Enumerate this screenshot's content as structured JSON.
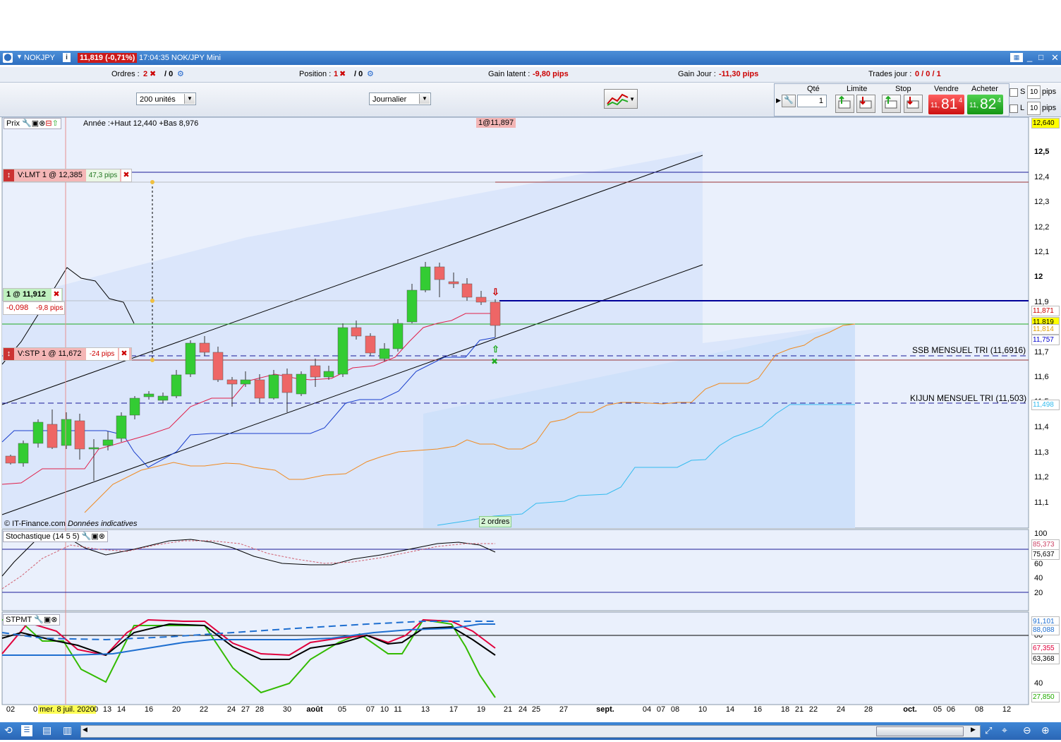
{
  "window": {
    "instrument": "NOKJPY",
    "price_badge": "11,819 (-0,71%)",
    "time_title": "17:04:35 NOK/JPY Mini"
  },
  "infobar": {
    "orders_label": "Ordres :",
    "orders_value": "2",
    "orders_sep": "/ 0",
    "position_label": "Position :",
    "position_value": "1",
    "position_sep": "/ 0",
    "latent_label": "Gain latent :",
    "latent_value": "-9,80 pips",
    "day_label": "Gain Jour :",
    "day_value": "-11,30 pips",
    "trades_label": "Trades jour :",
    "trades_value": "0 / 0 / 1"
  },
  "toolbar": {
    "units_select": "200 unités",
    "period_select": "Journalier",
    "qty_label": "Qté",
    "qty_value": "1",
    "limit_label": "Limite",
    "stop_label": "Stop",
    "sell_label": "Vendre",
    "buy_label": "Acheter",
    "sell_small": "11,",
    "sell_big": "81",
    "sell_sup": "4",
    "buy_small": "11,",
    "buy_big": "82",
    "buy_sup": "4",
    "s_label": "S",
    "l_label": "L",
    "s_pips": "10",
    "l_pips": "10",
    "pips_unit": "pips"
  },
  "price_panel": {
    "header": "Prix",
    "year_info": "Année :+Haut 12,440 +Bas 8,976",
    "top_order_tag": "1@11,897",
    "credit_1": "© IT-Finance.com",
    "credit_2": "Données indicatives",
    "orders_tag": "2 ordres",
    "ssb_label": "SSB MENSUEL TRI (11,6916)",
    "kijun_label": "KIJUN MENSUEL TRI (11,503)",
    "limit_order": {
      "label": "V:LMT  1 @ 12,385",
      "pips": "47,3 pips"
    },
    "position": {
      "label": "1 @ 11,912",
      "delta": "-0,098",
      "pips": "-9,8 pips"
    },
    "stop_order": {
      "label": "V:STP  1 @ 11,672",
      "pips": "-24 pips"
    },
    "y_ticks": [
      "12,5",
      "12,4",
      "12,3",
      "12,2",
      "12,1",
      "12",
      "11,9",
      "11,8",
      "11,7",
      "11,6",
      "11,5",
      "11,4",
      "11,3",
      "11,2",
      "11,1"
    ],
    "y_boxes": [
      {
        "text": "12,640",
        "bg": "#ffff00",
        "fg": "#000000"
      },
      {
        "text": "11,871",
        "bg": "#ffffff",
        "fg": "#cc0000"
      },
      {
        "text": "11,819",
        "bg": "#ffff00",
        "fg": "#000000"
      },
      {
        "text": "11,814",
        "bg": "#ffffff",
        "fg": "#e0a000"
      },
      {
        "text": "11,757",
        "bg": "#ffffff",
        "fg": "#0000cc"
      },
      {
        "text": "11,498",
        "bg": "#ffffff",
        "fg": "#33bbee"
      }
    ]
  },
  "stoch_panel": {
    "header": "Stochastique (14 5 5)",
    "y_ticks": [
      "100",
      "60",
      "40",
      "20"
    ],
    "y_boxes": [
      {
        "text": "85,373",
        "bg": "#ffffff",
        "fg": "#cc4466"
      },
      {
        "text": "75,637",
        "bg": "#ffffff",
        "fg": "#000000"
      }
    ]
  },
  "stpmt_panel": {
    "header": "STPMT",
    "y_ticks": [
      "80",
      "40"
    ],
    "y_boxes": [
      {
        "text": "91,101",
        "bg": "#ffffff",
        "fg": "#1f6fd0"
      },
      {
        "text": "88,088",
        "bg": "#ffffff",
        "fg": "#1f6fd0"
      },
      {
        "text": "67,355",
        "bg": "#ffffff",
        "fg": "#e0003c"
      },
      {
        "text": "63,368",
        "bg": "#ffffff",
        "fg": "#000000"
      },
      {
        "text": "27,850",
        "bg": "#ffffff",
        "fg": "#22aa00"
      }
    ]
  },
  "x_axis": {
    "cursor_label": "mer. 8 juil. 2020",
    "labels": [
      {
        "t": "02",
        "x": 15
      },
      {
        "t": "0",
        "x": 50
      },
      {
        "t": "0",
        "x": 136
      },
      {
        "t": "13",
        "x": 152
      },
      {
        "t": "14",
        "x": 172
      },
      {
        "t": "16",
        "x": 211
      },
      {
        "t": "20",
        "x": 250
      },
      {
        "t": "22",
        "x": 289
      },
      {
        "t": "24",
        "x": 328
      },
      {
        "t": "27",
        "x": 348
      },
      {
        "t": "28",
        "x": 368
      },
      {
        "t": "30",
        "x": 407
      },
      {
        "t": "août",
        "x": 446
      },
      {
        "t": "05",
        "x": 485
      },
      {
        "t": "07",
        "x": 525
      },
      {
        "t": "10",
        "x": 545
      },
      {
        "t": "11",
        "x": 564
      },
      {
        "t": "13",
        "x": 603
      },
      {
        "t": "17",
        "x": 643
      },
      {
        "t": "19",
        "x": 682
      },
      {
        "t": "21",
        "x": 720
      },
      {
        "t": "24",
        "x": 741
      },
      {
        "t": "25",
        "x": 760
      },
      {
        "t": "27",
        "x": 799
      },
      {
        "t": "sept.",
        "x": 858
      },
      {
        "t": "04",
        "x": 917
      },
      {
        "t": "07",
        "x": 937
      },
      {
        "t": "08",
        "x": 957
      },
      {
        "t": "10",
        "x": 996
      },
      {
        "t": "14",
        "x": 1035
      },
      {
        "t": "16",
        "x": 1074
      },
      {
        "t": "18",
        "x": 1113
      },
      {
        "t": "21",
        "x": 1133
      },
      {
        "t": "22",
        "x": 1153
      },
      {
        "t": "24",
        "x": 1192
      },
      {
        "t": "28",
        "x": 1231
      },
      {
        "t": "oct.",
        "x": 1290
      },
      {
        "t": "05",
        "x": 1329
      },
      {
        "t": "06",
        "x": 1348
      },
      {
        "t": "08",
        "x": 1388
      },
      {
        "t": "12",
        "x": 1427
      }
    ]
  },
  "colors": {
    "bull": "#33cc33",
    "bear": "#ee6666",
    "tenkan": "#e0204a",
    "kijun": "#1a3fcc",
    "senkou_a": "#f08a20",
    "senkou_b": "#33bbee",
    "cloud": "#dbe6fb"
  }
}
